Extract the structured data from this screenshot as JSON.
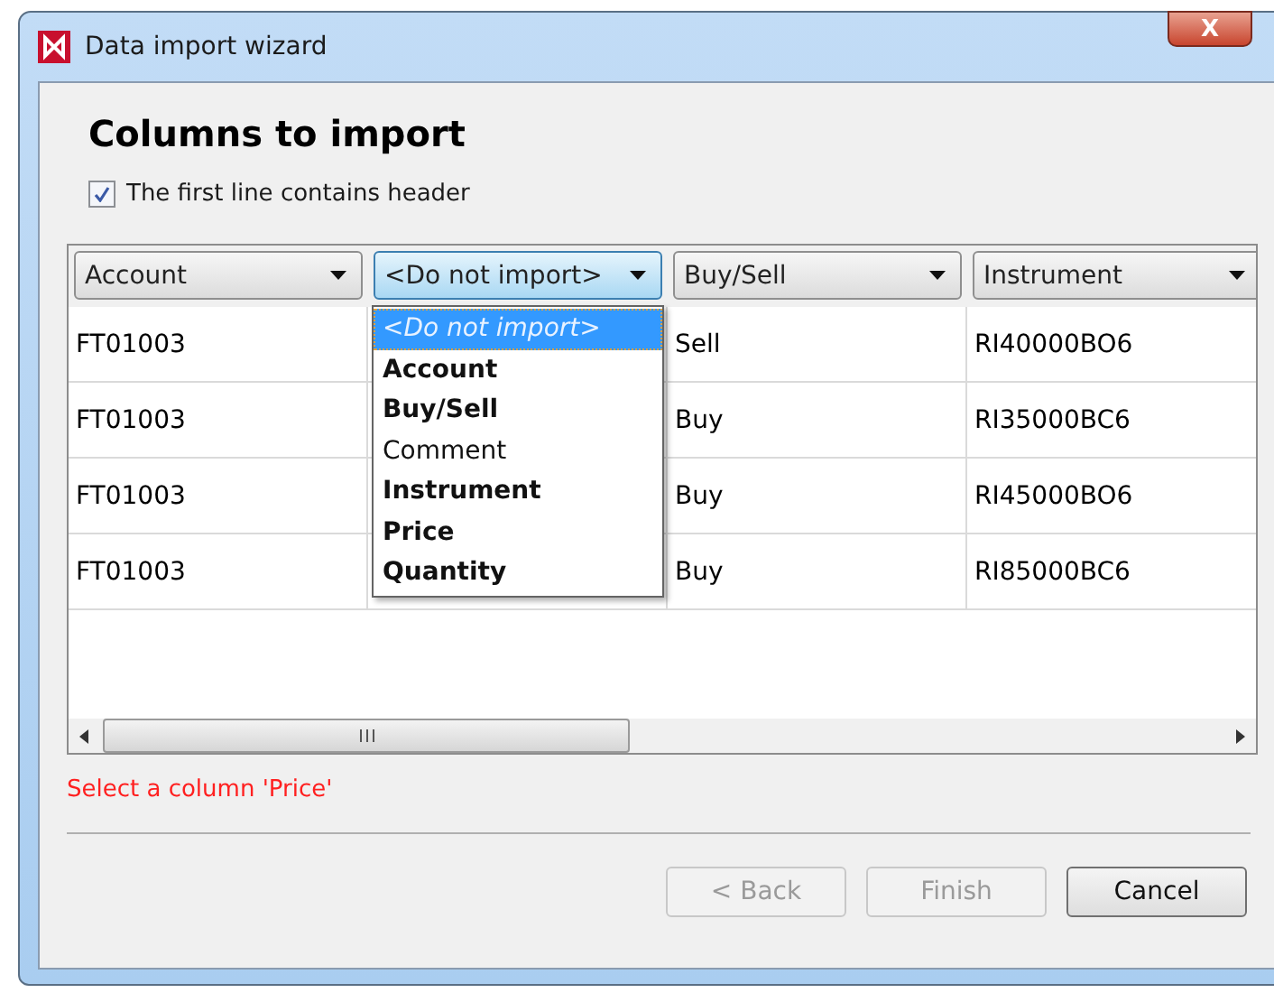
{
  "window": {
    "title": "Data import wizard",
    "close": "X"
  },
  "heading": "Columns to import",
  "header_checkbox": {
    "label": "The first line contains header",
    "checked": true
  },
  "columns": [
    {
      "label": "Account",
      "open": false
    },
    {
      "label": "<Do not import>",
      "open": true
    },
    {
      "label": "Buy/Sell",
      "open": false
    },
    {
      "label": "Instrument",
      "open": false
    }
  ],
  "dropdown": {
    "items": [
      {
        "label": "<Do not import>",
        "selected": true,
        "required": false
      },
      {
        "label": "Account",
        "selected": false,
        "required": true
      },
      {
        "label": "Buy/Sell",
        "selected": false,
        "required": true
      },
      {
        "label": "Comment",
        "selected": false,
        "required": false
      },
      {
        "label": "Instrument",
        "selected": false,
        "required": true
      },
      {
        "label": "Price",
        "selected": false,
        "required": true
      },
      {
        "label": "Quantity",
        "selected": false,
        "required": true
      }
    ]
  },
  "rows": [
    [
      "FT01003",
      null,
      "Sell",
      "RI40000BO6"
    ],
    [
      "FT01003",
      null,
      "Buy",
      "RI35000BC6"
    ],
    [
      "FT01003",
      null,
      "Buy",
      "RI45000BO6"
    ],
    [
      "FT01003",
      null,
      "Buy",
      "RI85000BC6"
    ]
  ],
  "error": "Select a column 'Price'",
  "buttons": [
    {
      "label": "< Back",
      "disabled": true
    },
    {
      "label": "Finish",
      "disabled": true
    },
    {
      "label": "Cancel",
      "disabled": false
    }
  ]
}
